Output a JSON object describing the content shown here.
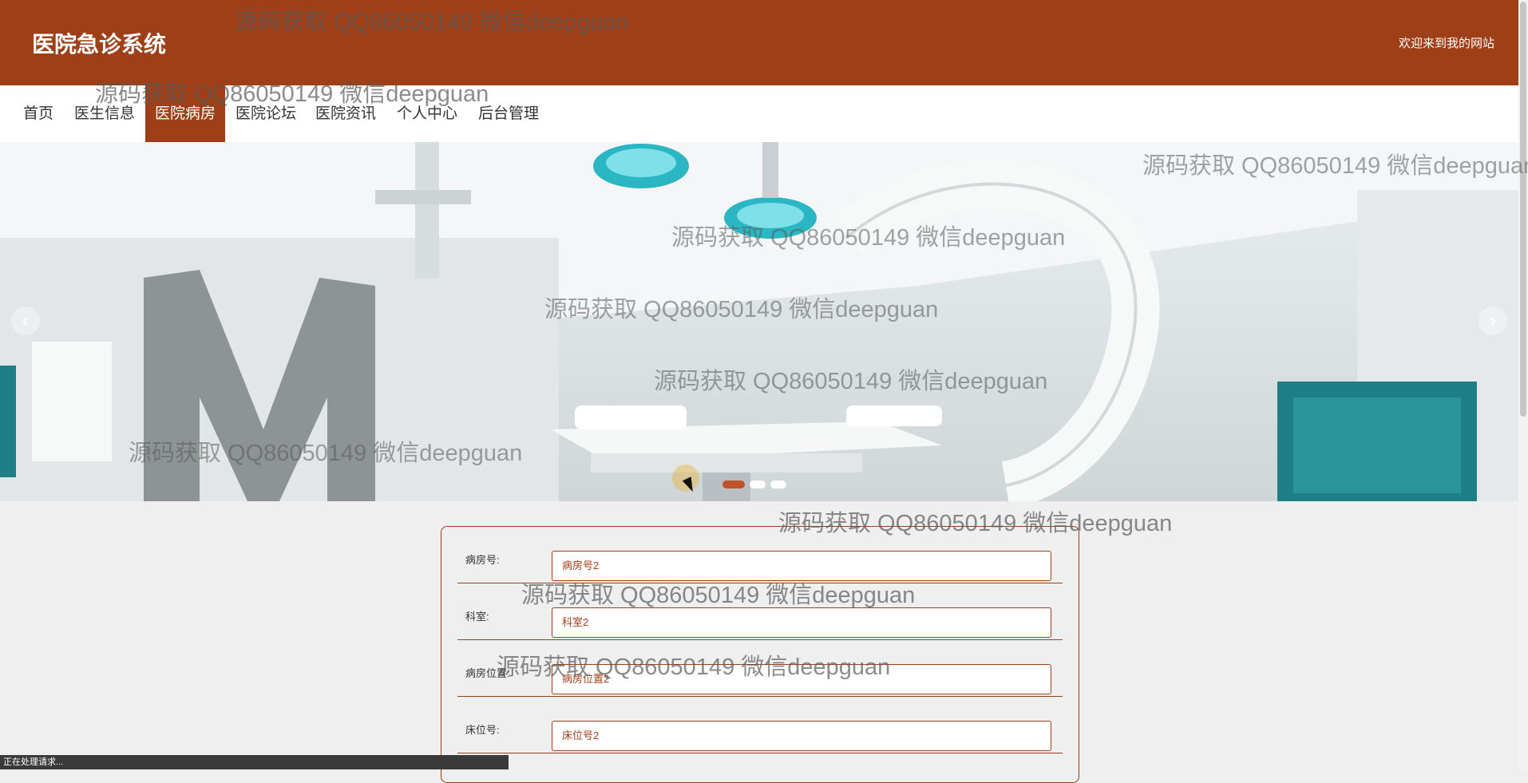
{
  "header": {
    "title": "医院急诊系统",
    "welcome": "欢迎来到我的网站"
  },
  "nav": {
    "items": [
      {
        "label": "首页"
      },
      {
        "label": "医生信息"
      },
      {
        "label": "医院病房"
      },
      {
        "label": "医院论坛"
      },
      {
        "label": "医院资讯"
      },
      {
        "label": "个人中心"
      },
      {
        "label": "后台管理"
      }
    ],
    "active_index": 2
  },
  "carousel": {
    "prev_icon": "chevron-left-icon",
    "next_icon": "chevron-right-icon",
    "slide_count": 3,
    "active_slide": 1
  },
  "form": {
    "fields": [
      {
        "label": "病房号:",
        "value": "病房号2"
      },
      {
        "label": "科室:",
        "value": "科室2"
      },
      {
        "label": "病房位置:",
        "value": "病房位置2"
      },
      {
        "label": "床位号:",
        "value": "床位号2"
      }
    ]
  },
  "status_bar": {
    "text": "正在处理请求..."
  },
  "watermark": {
    "text": "源码获取 QQ86050149 微信deepguan"
  },
  "colors": {
    "brand": "#9e3f18",
    "page_bg": "#efefef"
  }
}
